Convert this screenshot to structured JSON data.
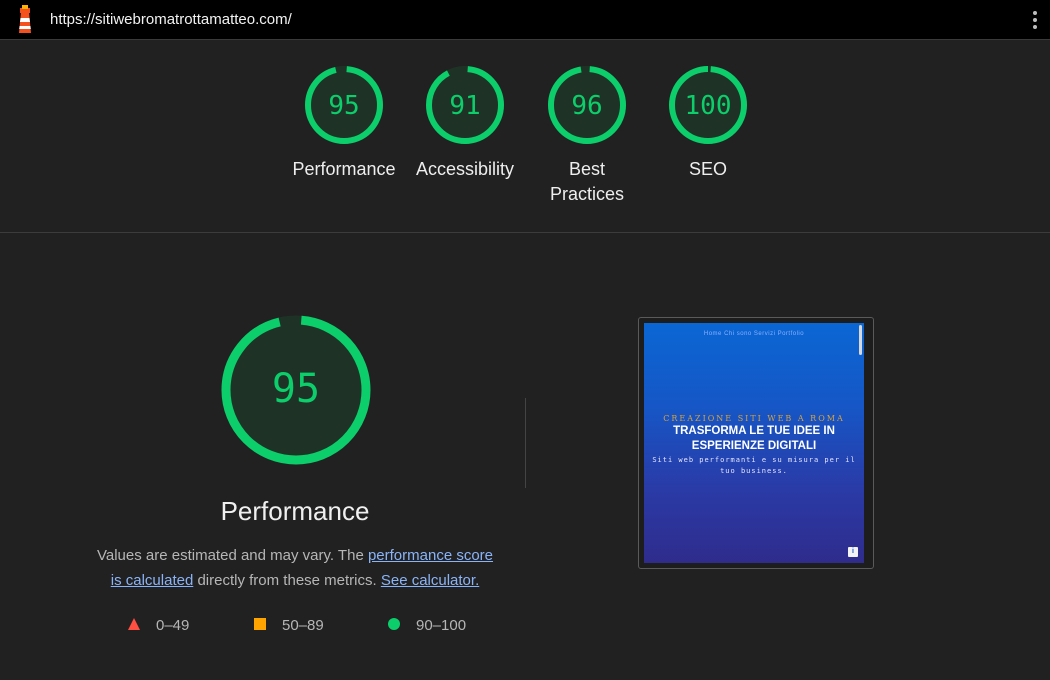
{
  "topbar": {
    "url": "https://sitiwebromatrottamatteo.com/",
    "logo_icon": "lighthouse-icon",
    "menu_icon": "kebab-menu-icon"
  },
  "colors": {
    "pass": "#0cce6b",
    "pass_bg": "#1e3326",
    "average": "#ffa400",
    "fail": "#ff4e42"
  },
  "categories": [
    {
      "score": 95,
      "label": "Performance"
    },
    {
      "score": 91,
      "label": "Accessibility"
    },
    {
      "score": 96,
      "label_line1": "Best",
      "label_line2": "Practices"
    },
    {
      "score": 100,
      "label": "SEO"
    }
  ],
  "performance": {
    "score": 95,
    "title": "Performance",
    "desc_before": "Values are estimated and may vary. The ",
    "link_score": "performance score is calculated",
    "link_score_part1": "performance score",
    "link_score_part2": "is calculated",
    "desc_middle": " directly from these metrics. ",
    "link_calc": "See calculator."
  },
  "legend": [
    {
      "shape": "triangle-icon",
      "range": "0–49"
    },
    {
      "shape": "square-icon",
      "range": "50–89"
    },
    {
      "shape": "circle-icon",
      "range": "90–100"
    }
  ],
  "screenshot": {
    "nav": "Home   Chi sono   Servizi   Portfolio",
    "kicker": "CREAZIONE SITI WEB A ROMA",
    "headline_line1": "TRASFORMA LE TUE IDEE IN",
    "headline_line2": "ESPERIENZE DIGITALI",
    "sub_line1": "Siti web performanti e su misura per il",
    "sub_line2": "tuo business."
  }
}
